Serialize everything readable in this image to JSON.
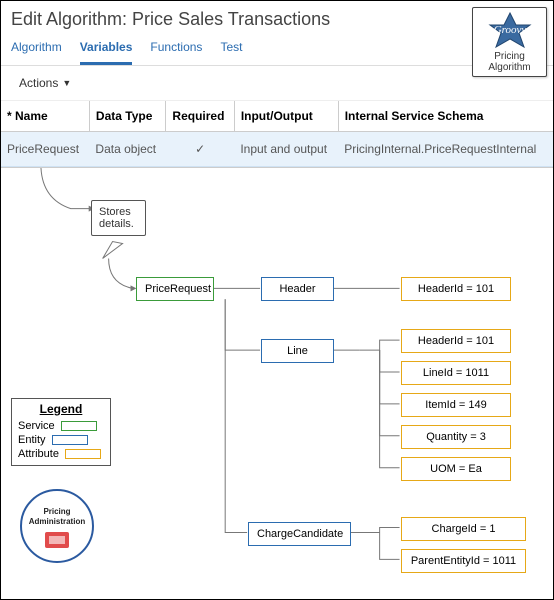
{
  "header": {
    "title": "Edit Algorithm: Price Sales Transactions",
    "tabs": [
      "Algorithm",
      "Variables",
      "Functions",
      "Test"
    ],
    "active_tab": "Variables",
    "actions_label": "Actions"
  },
  "columns": {
    "name": "Name",
    "data_type": "Data Type",
    "required": "Required",
    "io": "Input/Output",
    "schema": "Internal Service Schema"
  },
  "row": {
    "name": "PriceRequest",
    "data_type": "Data object",
    "required_glyph": "✓",
    "io": "Input and output",
    "schema": "PricingInternal.PriceRequestInternal"
  },
  "badge": {
    "title_line1": "Groovy",
    "text_line1": "Pricing",
    "text_line2": "Algorithm"
  },
  "diagram": {
    "callout": "Stores details.",
    "service_node": "PriceRequest",
    "entities": {
      "header": "Header",
      "line": "Line",
      "charge": "ChargeCandidate"
    },
    "attrs": {
      "header": [
        "HeaderId  = 101"
      ],
      "line": [
        "HeaderId  = 101",
        "LineId  = 1011",
        "ItemId  = 149",
        "Quantity  = 3",
        "UOM = Ea"
      ],
      "charge": [
        "ChargeId  = 1",
        "ParentEntityId = 1011"
      ]
    }
  },
  "legend": {
    "title": "Legend",
    "items": [
      {
        "label": "Service",
        "color": "#3a9b3a"
      },
      {
        "label": "Entity",
        "color": "#2b6cb0"
      },
      {
        "label": "Attribute",
        "color": "#e6a817"
      }
    ]
  },
  "admin_badge": {
    "line1": "Pricing",
    "line2": "Administration"
  }
}
